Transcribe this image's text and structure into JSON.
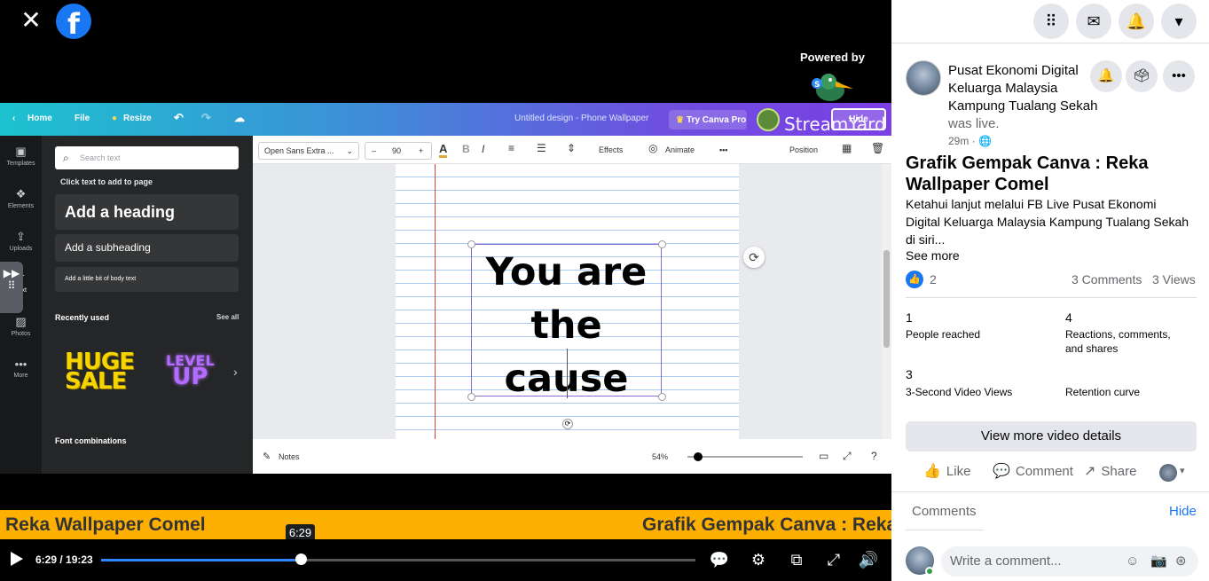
{
  "player": {
    "close_icon": "✕",
    "fb_logo": "f",
    "powered_by": "Powered by",
    "ticker_left": "Reka Wallpaper Comel",
    "ticker_right": "Grafik Gempak Canva : Reka W",
    "tooltip_time": "6:29",
    "time_display": "6:29 / 19:23",
    "progress_fraction": 0.3365
  },
  "canva": {
    "top_home": "Home",
    "top_file": "File",
    "top_resize": "Resize",
    "doc_title": "Untitled design - Phone Wallpaper",
    "try_pro": "Try Canva Pro",
    "streamyard": "StreamYard",
    "hide_chip": "Hide",
    "rail": [
      {
        "label": "Templates",
        "icon": "▣"
      },
      {
        "label": "Elements",
        "icon": "❖"
      },
      {
        "label": "Uploads",
        "icon": "⇪"
      },
      {
        "label": "Text",
        "icon": "T"
      },
      {
        "label": "Photos",
        "icon": "▨"
      },
      {
        "label": "More",
        "icon": "•••"
      }
    ],
    "search_placeholder": "Search text",
    "click_hint": "Click text to add to page",
    "add_heading": "Add a heading",
    "add_subheading": "Add a subheading",
    "add_body": "Add a little bit of body text",
    "recently_used": "Recently used",
    "see_all": "See all",
    "huge_sale_l1": "HUGE",
    "huge_sale_l2": "SALE",
    "level_l1": "LEVEL",
    "level_l2": "UP",
    "font_combinations": "Font combinations",
    "font_name": "Open Sans Extra ...",
    "font_size": "90",
    "effects": "Effects",
    "animate": "Animate",
    "position": "Position",
    "canvas_line1": "You are",
    "canvas_line2": "the cause",
    "notes": "Notes",
    "zoom": "54%"
  },
  "sidebar": {
    "page_name": "Pusat Ekonomi Digital Keluarga Malaysia Kampung Tualang Sekah",
    "was_live": "was live.",
    "time_ago": "29m",
    "video_title": "Grafik Gempak Canva : Reka Wallpaper Comel",
    "description": "Ketahui lanjut melalui FB Live Pusat Ekonomi Digital Keluarga Malaysia Kampung Tualang Sekah di siri...",
    "see_more": "See more",
    "reactions_count": "2",
    "comments_count": "3 Comments",
    "views_count": "3 Views",
    "stats": [
      {
        "value": "1",
        "label": "People reached"
      },
      {
        "value": "4",
        "label": "Reactions, comments, and shares"
      },
      {
        "value": "3",
        "label": "3-Second Video Views"
      },
      {
        "value": "",
        "label": "Retention curve"
      }
    ],
    "view_more": "View more video details",
    "like": "Like",
    "comment": "Comment",
    "share": "Share",
    "comments_label": "Comments",
    "hide": "Hide",
    "write_comment_placeholder": "Write a comment..."
  }
}
